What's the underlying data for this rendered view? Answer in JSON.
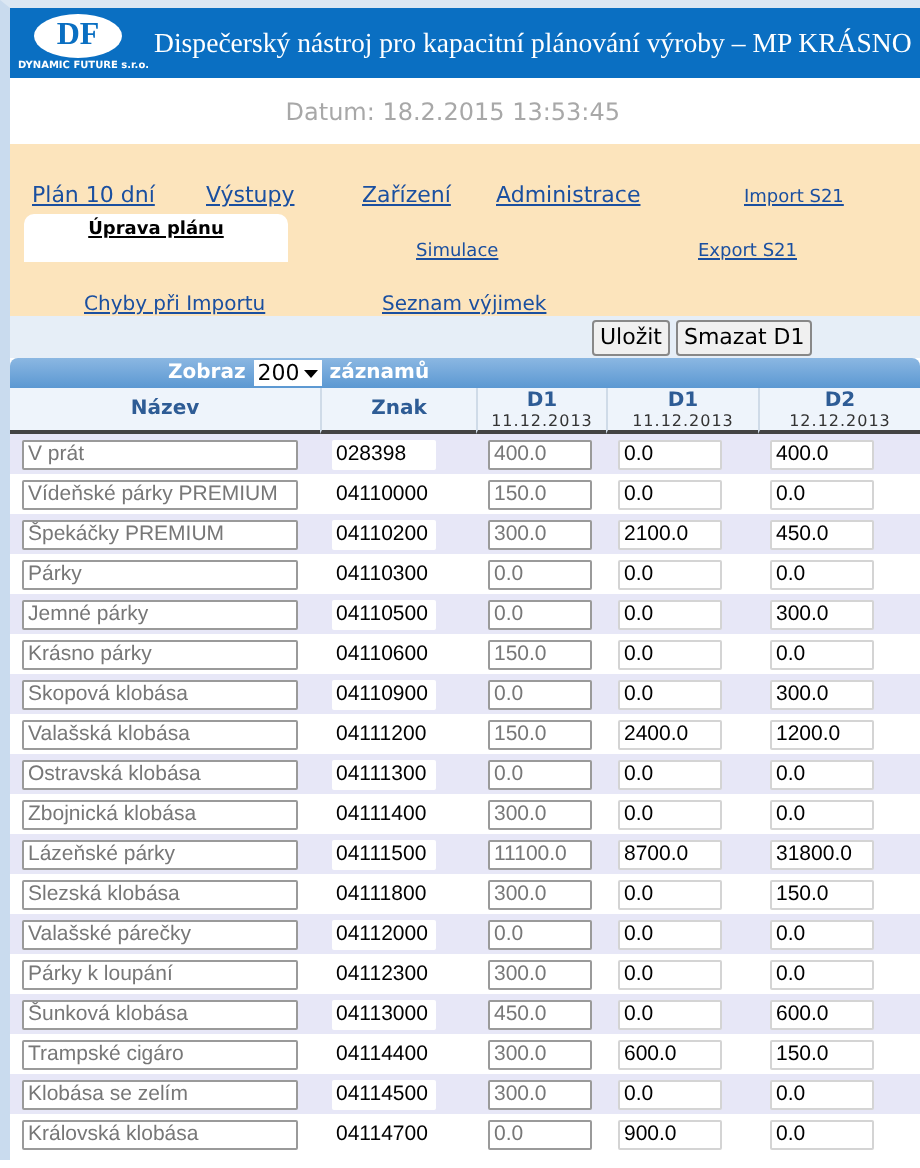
{
  "header": {
    "logo": "DF",
    "logo_caption": "DYNAMIC FUTURE s.r.o.",
    "title": "Dispečerský nástroj pro kapacitní plánování výroby – MP KRÁSNO"
  },
  "date": "Datum: 18.2.2015 13:53:45",
  "nav_rows": [
    {
      "items": [
        {
          "label": "Plán 10 dní",
          "selected": false
        },
        {
          "label": "Výstupy",
          "selected": false
        },
        {
          "label": "Zařízení",
          "selected": false
        },
        {
          "label": "Administrace",
          "selected": false
        },
        {
          "label": "Import S21",
          "selected": false
        }
      ]
    },
    {
      "items": [
        {
          "label": "Úprava plánu",
          "selected": true
        },
        {
          "label": "Simulace",
          "selected": false
        },
        {
          "label": "Export S21",
          "selected": false
        }
      ]
    },
    {
      "items": [
        {
          "label": "Chyby při Importu",
          "selected": false
        },
        {
          "label": "Seznam výjimek",
          "selected": false
        }
      ]
    }
  ],
  "buttons": [
    "Uložit",
    "Smazat D1"
  ],
  "table": {
    "show_label": "Zobraz",
    "page_size": "200",
    "records_label": "záznamů",
    "columns": [
      {
        "title": "Název",
        "kind": "field",
        "disabled": true
      },
      {
        "title": "Znak",
        "kind": "plain"
      },
      {
        "title": "D1",
        "subtitle": "11.12.2013",
        "kind": "field",
        "disabled": true
      },
      {
        "title": "D1",
        "subtitle": "11.12.2013",
        "kind": "field",
        "disabled": false
      },
      {
        "title": "D2",
        "subtitle": "12.12.2013",
        "kind": "field",
        "disabled": false
      }
    ],
    "rows": [
      {
        "cells": [
          "V prát",
          "028398",
          "400.0",
          "0.0",
          "400.0"
        ]
      },
      {
        "cells": [
          "Vídeňské párky PREMIUM",
          "04110000",
          "150.0",
          "0.0",
          "0.0"
        ]
      },
      {
        "cells": [
          "Špekáčky PREMIUM",
          "04110200",
          "300.0",
          "2100.0",
          "450.0"
        ]
      },
      {
        "cells": [
          "Párky",
          "04110300",
          "0.0",
          "0.0",
          "0.0"
        ]
      },
      {
        "cells": [
          "Jemné párky",
          "04110500",
          "0.0",
          "0.0",
          "300.0"
        ]
      },
      {
        "cells": [
          "Krásno párky",
          "04110600",
          "150.0",
          "0.0",
          "0.0"
        ]
      },
      {
        "cells": [
          "Skopová klobása",
          "04110900",
          "0.0",
          "0.0",
          "300.0"
        ]
      },
      {
        "cells": [
          "Valašská klobása",
          "04111200",
          "150.0",
          "2400.0",
          "1200.0"
        ]
      },
      {
        "cells": [
          "Ostravská klobása",
          "04111300",
          "0.0",
          "0.0",
          "0.0"
        ]
      },
      {
        "cells": [
          "Zbojnická klobása",
          "04111400",
          "300.0",
          "0.0",
          "0.0"
        ]
      },
      {
        "cells": [
          "Lázeňské párky",
          "04111500",
          "11100.0",
          "8700.0",
          "31800.0"
        ]
      },
      {
        "cells": [
          "Slezská klobása",
          "04111800",
          "300.0",
          "0.0",
          "150.0"
        ]
      },
      {
        "cells": [
          "Valašské párečky",
          "04112000",
          "0.0",
          "0.0",
          "0.0"
        ]
      },
      {
        "cells": [
          "Párky k loupání",
          "04112300",
          "300.0",
          "0.0",
          "0.0"
        ]
      },
      {
        "cells": [
          "Šunková klobása",
          "04113000",
          "450.0",
          "0.0",
          "600.0"
        ]
      },
      {
        "cells": [
          "Trampské cigáro",
          "04114400",
          "300.0",
          "600.0",
          "150.0"
        ]
      },
      {
        "cells": [
          "Klobása se zelím",
          "04114500",
          "300.0",
          "0.0",
          "0.0"
        ]
      },
      {
        "cells": [
          "Královská klobása",
          "04114700",
          "0.0",
          "900.0",
          "0.0"
        ]
      }
    ]
  }
}
